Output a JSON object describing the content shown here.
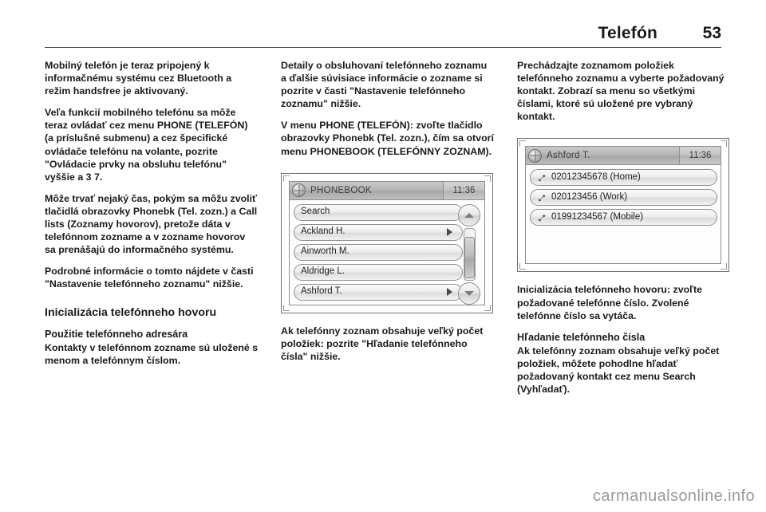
{
  "header": {
    "title": "Telefón",
    "page_number": "53"
  },
  "column1": {
    "paragraphs": [
      "Mobilný telefón je teraz pripojený k informačnému systému cez Bluetooth a režim handsfree je aktivovaný.",
      "Veľa funkcií mobilného telefónu sa môže teraz ovládať cez menu PHONE (TELEFÓN) (a príslušné submenu) a cez špecifické ovládače telefónu na volante, pozrite \"Ovládacie prvky na obsluhu telefónu\" vyššie a 3 7.",
      "Môže trvať nejaký čas, pokým sa môžu zvoliť tlačidlá obrazovky Phonebk (Tel. zozn.) a Call lists (Zoznamy hovorov), pretože dáta v telefónnom zozname a v zozname hovorov sa prenášajú do informačného systému.",
      "Podrobné informácie o tomto nájdete v časti \"Nastavenie telefónneho zoznamu\" nižšie."
    ],
    "section_heading": "Inicializácia telefónneho hovoru",
    "subsection_heading": "Použitie telefónneho adresára",
    "subsection_paragraphs": [
      "Kontakty v telefónnom zozname sú uložené s menom a telefónnym číslom."
    ]
  },
  "column2": {
    "paragraphs": [
      "Detaily o obsluhovaní telefónneho zoznamu a ďalšie súvisiace informácie o zozname si pozrite v časti \"Nastavenie telefónneho zoznamu\" nižšie.",
      "V menu PHONE (TELEFÓN): zvoľte tlačidlo obrazovky Phonebk (Tel. zozn.), čím sa otvorí menu PHONEBOOK (TELEFÓNNY ZOZNAM)."
    ],
    "screenshot": {
      "status_title": "PHONEBOOK",
      "clock": "11:36",
      "globe_icon": "globe-icon",
      "items": [
        {
          "label": "Search",
          "has_arrow": false
        },
        {
          "label": "Ackland H.",
          "has_arrow": true
        },
        {
          "label": "Ainworth M.",
          "has_arrow": false
        },
        {
          "label": "Aldridge L.",
          "has_arrow": false
        },
        {
          "label": "Ashford T.",
          "has_arrow": true
        }
      ],
      "scroll_up_icon": "chevron-up-icon",
      "scroll_down_icon": "chevron-down-icon"
    },
    "after_paragraphs": [
      "Ak telefónny zoznam obsahuje veľký počet položiek: pozrite \"Hľadanie telefónneho čísla\" nižšie."
    ]
  },
  "column3": {
    "paragraphs": [
      "Prechádzajte zoznamom položiek telefónneho zoznamu a vyberte požadovaný kontakt. Zobrazí sa menu so všetkými číslami, ktoré sú uložené pre vybraný kontakt."
    ],
    "screenshot": {
      "status_title": "Ashford T.",
      "clock": "11:36",
      "globe_icon": "globe-icon",
      "items": [
        {
          "label": "02012345678 (Home)",
          "icon": "handset-icon"
        },
        {
          "label": "020123456 (Work)",
          "icon": "handset-icon"
        },
        {
          "label": "01991234567 (Mobile)",
          "icon": "handset-icon"
        }
      ]
    },
    "after_paragraphs": [
      "Inicializácia telefónneho hovoru: zvoľte požadované telefónne číslo. Zvolené telefónne číslo sa vytáča."
    ],
    "subsection_heading": "Hľadanie telefónneho čísla",
    "subsection_paragraphs": [
      "Ak telefónny zoznam obsahuje veľký počet položiek, môžete pohodlne hľadať požadovaný kontakt cez menu Search (Vyhľadať)."
    ]
  },
  "footer": {
    "watermark": "carmanualsonline.info"
  }
}
